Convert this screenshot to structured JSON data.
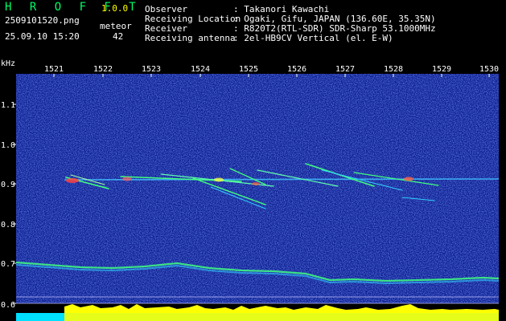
{
  "app": {
    "brand": "H R O F F T",
    "version": "1.0.0",
    "filename": "2509101520.png",
    "datetime": "25.09.10 15:20",
    "counter_label": "meteor",
    "counter_value": "42"
  },
  "station": {
    "rows": [
      {
        "label": "Observer",
        "value": ": Takanori Kawachi"
      },
      {
        "label": "Receiving Location",
        "value": ": Ogaki, Gifu, JAPAN (136.60E, 35.35N)"
      },
      {
        "label": "Receiver",
        "value": ": R820T2(RTL-SDR) SDR-Sharp 53.1000MHz"
      },
      {
        "label": "Receiving antenna",
        "value": ": 2el-HB9CV Vertical (el. E-W)"
      }
    ]
  },
  "spectrogram": {
    "y_unit": "kHz",
    "y_ticks": [
      "1.1",
      "1.0",
      "0.9",
      "0.8",
      "0.7",
      "0.6"
    ],
    "x_ticks": [
      "1521",
      "1522",
      "1523",
      "1524",
      "1525",
      "1526",
      "1527",
      "1528",
      "1529",
      "1530"
    ],
    "colors": {
      "background": "#0a1a8c",
      "noise": "#3050ff",
      "trace": "#40ff80",
      "hot": "#ff4040",
      "level": "#ffff00",
      "floor": "#00e0ff",
      "axis": "#ffffff"
    }
  }
}
